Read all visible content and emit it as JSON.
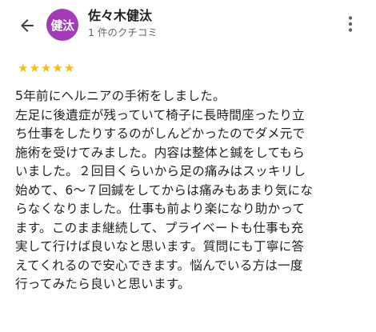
{
  "header": {
    "back_icon": "arrow-left-icon",
    "avatar_initials": "健汰",
    "avatar_color": "#a33ab8",
    "user_name": "佐々木健汰",
    "review_count": "1 件のクチコミ",
    "more_icon": "more-vertical-icon"
  },
  "rating": {
    "value": 5,
    "max": 5,
    "star_color": "#fbbc04",
    "stars": [
      "★",
      "★",
      "★",
      "★",
      "★"
    ]
  },
  "review": {
    "lines": [
      "5年前にヘルニアの手術をしました。",
      "左足に後遺症が残っていて椅子に長時間座ったり立",
      "ち仕事をしたりするのがしんどかったのでダメ元で",
      "施術を受けてみました。内容は整体と鍼をしてもら",
      "いました。２回目くらいから足の痛みはスッキリし",
      "始めて、6〜７回鍼をしてからは痛みもあまり気にな",
      "らなくなりました。仕事も前より楽になり助かって",
      "ます。このまま継続して、プライベートも仕事も充",
      "実して行けば良いなと思います。質問にも丁寧に答",
      "えてくれるので安心できます。悩んでいる方は一度",
      "行ってみたら良いと思います。"
    ]
  }
}
